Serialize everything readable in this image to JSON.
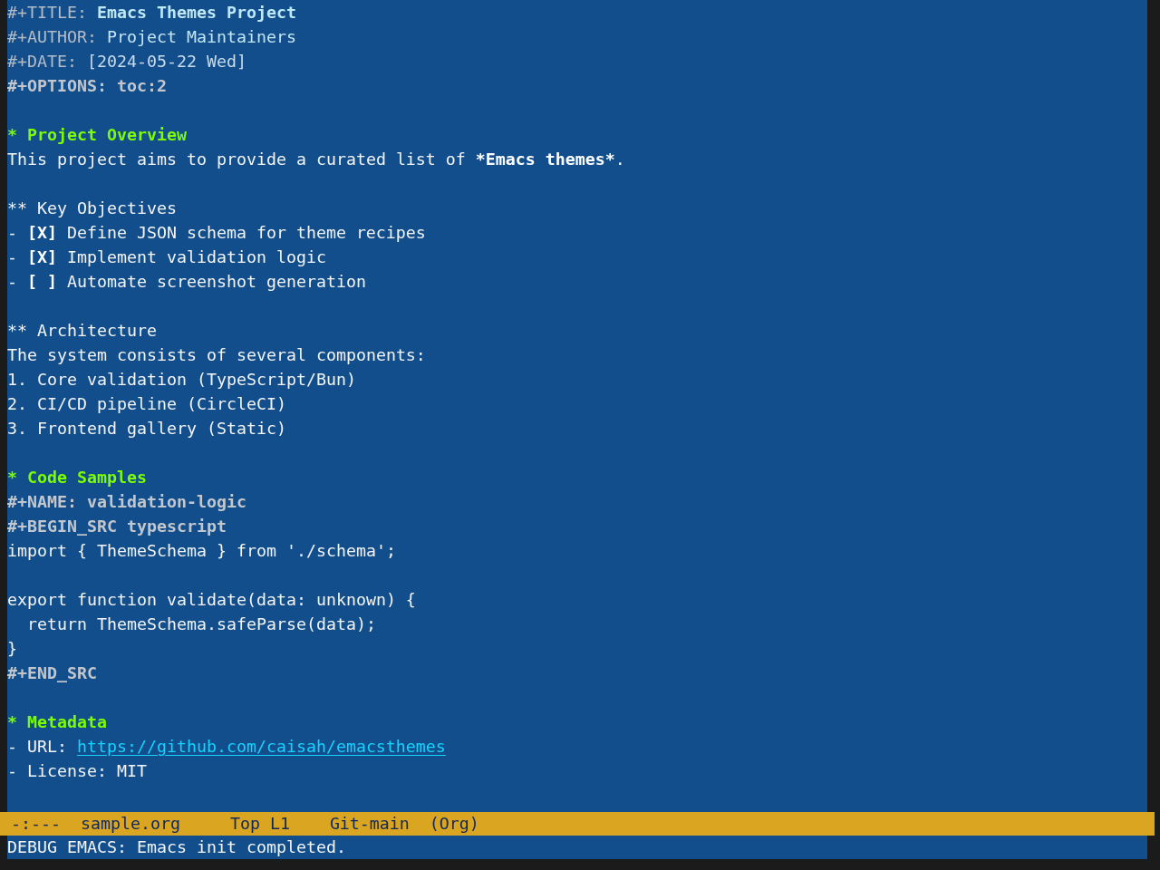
{
  "buffer": {
    "lines": [
      {
        "kind": "title",
        "key": "#+TITLE:",
        "value": "Emacs Themes Project"
      },
      {
        "kind": "author",
        "key": "#+AUTHOR:",
        "value": "Project Maintainers"
      },
      {
        "kind": "date",
        "key": "#+DATE:",
        "value": "[2024-05-22 Wed]"
      },
      {
        "kind": "meta",
        "text": "#+OPTIONS: toc:2"
      },
      {
        "kind": "blank"
      },
      {
        "kind": "heading",
        "text": "* Project Overview"
      },
      {
        "kind": "paragraph",
        "segments": [
          {
            "text": "This project aims to provide a curated list of ",
            "bold": false
          },
          {
            "text": "*Emacs themes*",
            "bold": true
          },
          {
            "text": ".",
            "bold": false
          }
        ]
      },
      {
        "kind": "blank"
      },
      {
        "kind": "subheading",
        "text": "** Key Objectives"
      },
      {
        "kind": "checklist",
        "bullet": "-",
        "box": "[X]",
        "text": "Define JSON schema for theme recipes"
      },
      {
        "kind": "checklist",
        "bullet": "-",
        "box": "[X]",
        "text": "Implement validation logic"
      },
      {
        "kind": "checklist",
        "bullet": "-",
        "box": "[ ]",
        "text": "Automate screenshot generation"
      },
      {
        "kind": "blank"
      },
      {
        "kind": "subheading",
        "text": "** Architecture"
      },
      {
        "kind": "text",
        "text": "The system consists of several components:"
      },
      {
        "kind": "list_item",
        "text": "1. Core validation (TypeScript/Bun)"
      },
      {
        "kind": "list_item",
        "text": "2. CI/CD pipeline (CircleCI)"
      },
      {
        "kind": "list_item",
        "text": "3. Frontend gallery (Static)"
      },
      {
        "kind": "blank"
      },
      {
        "kind": "heading",
        "text": "* Code Samples"
      },
      {
        "kind": "meta",
        "text": "#+NAME: validation-logic"
      },
      {
        "kind": "meta",
        "text": "#+BEGIN_SRC typescript"
      },
      {
        "kind": "code",
        "text": "import { ThemeSchema } from './schema';",
        "indented": false
      },
      {
        "kind": "blank"
      },
      {
        "kind": "code",
        "text": "export function validate(data: unknown) {",
        "indented": false
      },
      {
        "kind": "code",
        "text": "return ThemeSchema.safeParse(data);",
        "indented": true
      },
      {
        "kind": "code",
        "text": "}",
        "indented": false
      },
      {
        "kind": "meta",
        "text": "#+END_SRC"
      },
      {
        "kind": "blank"
      },
      {
        "kind": "heading",
        "text": "* Metadata"
      },
      {
        "kind": "link",
        "label": "- URL:",
        "url": "https://github.com/caisah/emacsthemes"
      },
      {
        "kind": "list_item",
        "text": "- License: MIT"
      }
    ]
  },
  "mode_line": {
    "status": "-:---",
    "buffer_name": "sample.org",
    "position": "Top L1",
    "vc_branch": "Git-main",
    "major_mode": "(Org)"
  },
  "echo_area": {
    "message": "DEBUG EMACS: Emacs init completed."
  }
}
